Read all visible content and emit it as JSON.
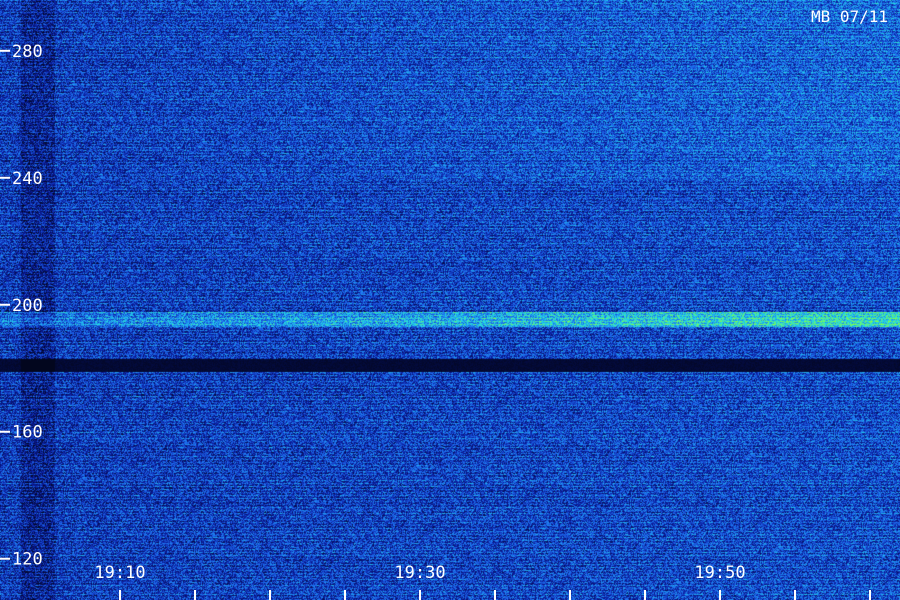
{
  "chart_data": {
    "type": "heatmap",
    "title": "MB 07/11",
    "xlabel": "",
    "ylabel": "",
    "y_ticks": [
      120,
      160,
      200,
      240,
      280
    ],
    "ylim": [
      107,
      296
    ],
    "x_tick_labels": [
      "19:10",
      "19:30",
      "19:50"
    ],
    "x_tick_minutes": [
      10,
      30,
      50
    ],
    "x_minor_tick_step_minutes": 5,
    "xlim_minutes": [
      2,
      62
    ],
    "bright_band_y": [
      193,
      198
    ],
    "dark_gap_y": [
      179,
      183
    ],
    "grid": false,
    "colors": {
      "background": "#02061e",
      "low": "#0a1a9a",
      "mid": "#1e6cf0",
      "high": "#22d8e8",
      "peak": "#7dff4a"
    }
  }
}
